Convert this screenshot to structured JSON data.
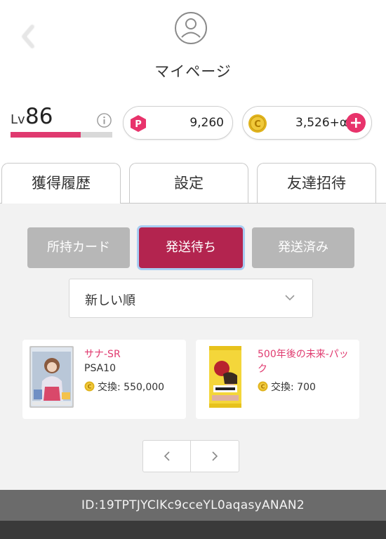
{
  "header": {
    "title": "マイページ",
    "back_icon": "chevron-left-icon",
    "avatar_icon": "user-icon"
  },
  "level": {
    "label": "Lv",
    "value": "86",
    "progress_percent": 69,
    "info_icon": "info-icon"
  },
  "points": {
    "icon_letter": "P",
    "value": "9,260",
    "color": "#e8336b"
  },
  "coins": {
    "icon_letter": "C",
    "value": "3,526+α",
    "color": "#e0b31c",
    "add_icon": "plus-icon"
  },
  "tabs": [
    {
      "label": "獲得履歴",
      "active": true
    },
    {
      "label": "設定",
      "active": false
    },
    {
      "label": "友達招待",
      "active": false
    }
  ],
  "segments": [
    {
      "label": "所持カード",
      "active": false
    },
    {
      "label": "発送待ち",
      "active": true
    },
    {
      "label": "発送済み",
      "active": false
    }
  ],
  "sort": {
    "selected": "新しい順",
    "icon": "chevron-down-icon"
  },
  "cards": [
    {
      "name": "サナ-SR",
      "grade": "PSA10",
      "price_label": "交換: 550,000",
      "image": "pokemon-card-image"
    },
    {
      "name": "500年後の未来-パック",
      "grade": "",
      "price_label": "交換: 700",
      "image": "one-piece-pack-image"
    }
  ],
  "pagination": {
    "prev_icon": "chevron-left-icon",
    "next_icon": "chevron-right-icon"
  },
  "footer": {
    "user_id": "ID:19TPTJYClKc9cceYL0aqasyANAN2"
  },
  "colors": {
    "accent": "#e03a6f",
    "active_segment": "#b3244f",
    "inactive_segment": "#b7b7b7",
    "footer_bg": "#6b6b6b"
  }
}
